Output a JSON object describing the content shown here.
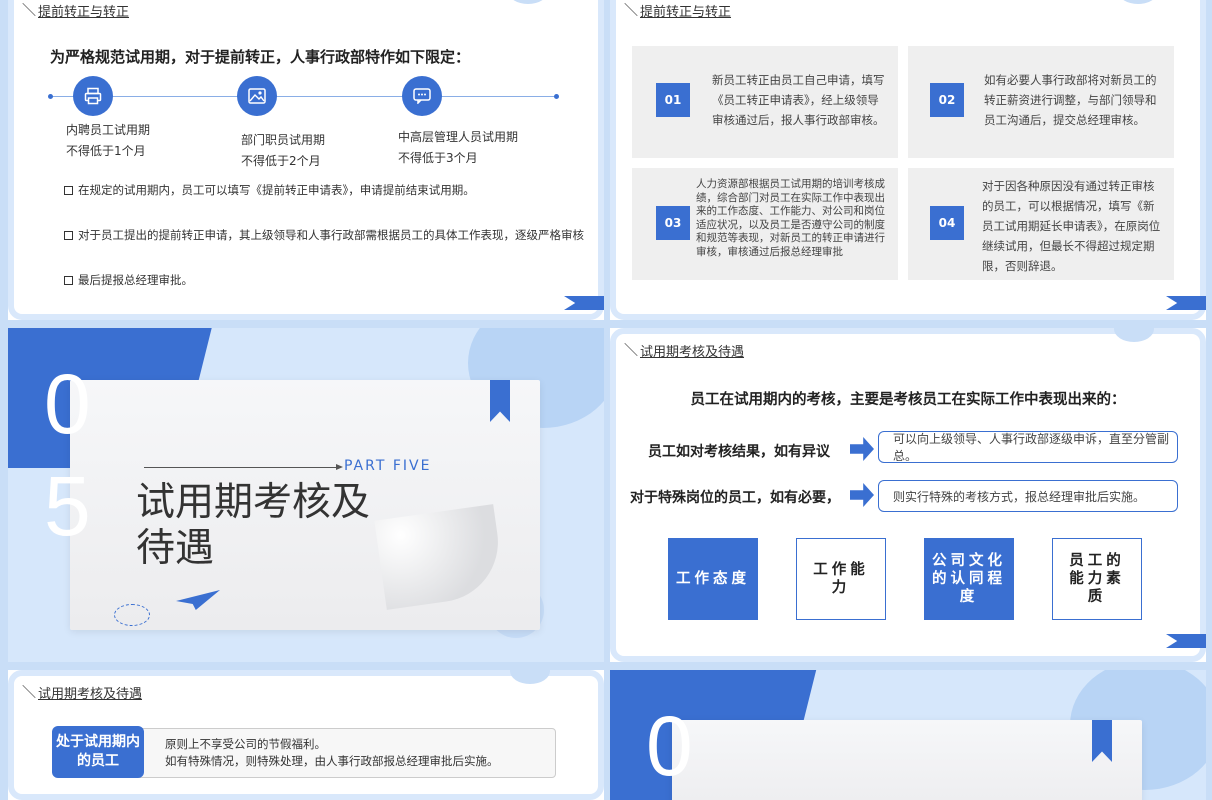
{
  "slide1": {
    "breadcrumb": "提前转正与转正",
    "title": "为严格规范试用期，对于提前转正，人事行政部特作如下限定：",
    "timeline": [
      {
        "icon": "printer-icon",
        "line1": "内聘员工试用期",
        "line2": "不得低于1个月"
      },
      {
        "icon": "image-icon",
        "line1": "部门职员试用期",
        "line2": "不得低于2个月"
      },
      {
        "icon": "chat-icon",
        "line1": "中高层管理人员试用期",
        "line2": "不得低于3个月"
      }
    ],
    "rules": [
      "在规定的试用期内，员工可以填写《提前转正申请表》，申请提前结束试用期。",
      "对于员工提出的提前转正申请，其上级领导和人事行政部需根据员工的具体工作表现，逐级严格审核",
      "最后提报总经理审批。"
    ]
  },
  "slide2": {
    "breadcrumb": "提前转正与转正",
    "cards": [
      {
        "num": "01",
        "text": "新员工转正由员工自己申请，填写《员工转正申请表》，经上级领导审核通过后，报人事行政部审核。"
      },
      {
        "num": "02",
        "text": "如有必要人事行政部将对新员工的转正薪资进行调整，与部门领导和员工沟通后，提交总经理审核。"
      },
      {
        "num": "03",
        "text": "人力资源部根据员工试用期的培训考核成绩，综合部门对员工在实际工作中表现出来的工作态度、工作能力、对公司和岗位适应状况，以及员工是否遵守公司的制度和规范等表现，对新员工的转正申请进行审核，审核通过后报总经理审批"
      },
      {
        "num": "04",
        "text": "对于因各种原因没有通过转正审核的员工，可以根据情况，填写《新员工试用期延长申请表》，在原岗位继续试用，但最长不得超过规定期限，否则辞退。"
      }
    ]
  },
  "slide3": {
    "digit1": "0",
    "digit2": "5",
    "part_label": "PART  FIVE",
    "title": "试用期考核及待遇"
  },
  "slide4": {
    "breadcrumb": "试用期考核及待遇",
    "heading": "员工在试用期内的考核，主要是考核员工在实际工作中表现出来的：",
    "conditions": [
      {
        "label": "员工如对考核结果，如有异议",
        "result": "可以向上级领导、人事行政部逐级申诉，直至分管副总。"
      },
      {
        "label": "对于特殊岗位的员工，如有必要，",
        "result": "则实行特殊的考核方式，报总经理审批后实施。"
      }
    ],
    "aspects": [
      "工作态度",
      "工作能力",
      "公司文化的认同程度",
      "员工的能力素质"
    ]
  },
  "slide5": {
    "breadcrumb": "试用期考核及待遇",
    "tag": "处于试用期内的员工",
    "line1": "原则上不享受公司的节假福利。",
    "line2": "如有特殊情况，则特殊处理，由人事行政部报总经理审批后实施。"
  },
  "slide6": {
    "digit1": "0"
  },
  "colors": {
    "accent": "#3a6fd1",
    "light": "#d6e7fb"
  }
}
